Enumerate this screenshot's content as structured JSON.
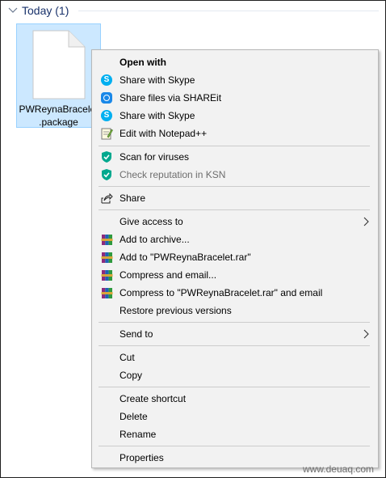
{
  "group": {
    "title": "Today (1)"
  },
  "file": {
    "name_line1": "PWReynaBracelet",
    "name_line2": ".package"
  },
  "menu": {
    "items": [
      {
        "label": "Open with",
        "icon": "none",
        "bold": true
      },
      {
        "label": "Share with Skype",
        "icon": "skype-icon"
      },
      {
        "label": "Share files via SHAREit",
        "icon": "shareit-icon"
      },
      {
        "label": "Share with Skype",
        "icon": "skype-icon"
      },
      {
        "label": "Edit with Notepad++",
        "icon": "notepad-plus-plus-icon"
      },
      {
        "label": "Scan for viruses",
        "icon": "kaspersky-shield-icon"
      },
      {
        "label": "Check reputation in KSN",
        "icon": "kaspersky-shield-icon",
        "disabled": true
      },
      {
        "label": "Share",
        "icon": "share-icon"
      },
      {
        "label": "Give access to",
        "icon": "none",
        "submenu": true
      },
      {
        "label": "Add to archive...",
        "icon": "winrar-icon"
      },
      {
        "label": "Add to \"PWReynaBracelet.rar\"",
        "icon": "winrar-icon"
      },
      {
        "label": "Compress and email...",
        "icon": "winrar-icon"
      },
      {
        "label": "Compress to \"PWReynaBracelet.rar\" and email",
        "icon": "winrar-icon"
      },
      {
        "label": "Restore previous versions",
        "icon": "none"
      },
      {
        "label": "Send to",
        "icon": "none",
        "submenu": true
      },
      {
        "label": "Cut",
        "icon": "none"
      },
      {
        "label": "Copy",
        "icon": "none"
      },
      {
        "label": "Create shortcut",
        "icon": "none"
      },
      {
        "label": "Delete",
        "icon": "none"
      },
      {
        "label": "Rename",
        "icon": "none"
      },
      {
        "label": "Properties",
        "icon": "none"
      }
    ]
  },
  "colors": {
    "selection": "#cce8ff",
    "menu_background": "#f2f2f2",
    "skype": "#00aff0",
    "kaspersky": "#00a88e"
  },
  "watermark": "www.deuaq.com"
}
